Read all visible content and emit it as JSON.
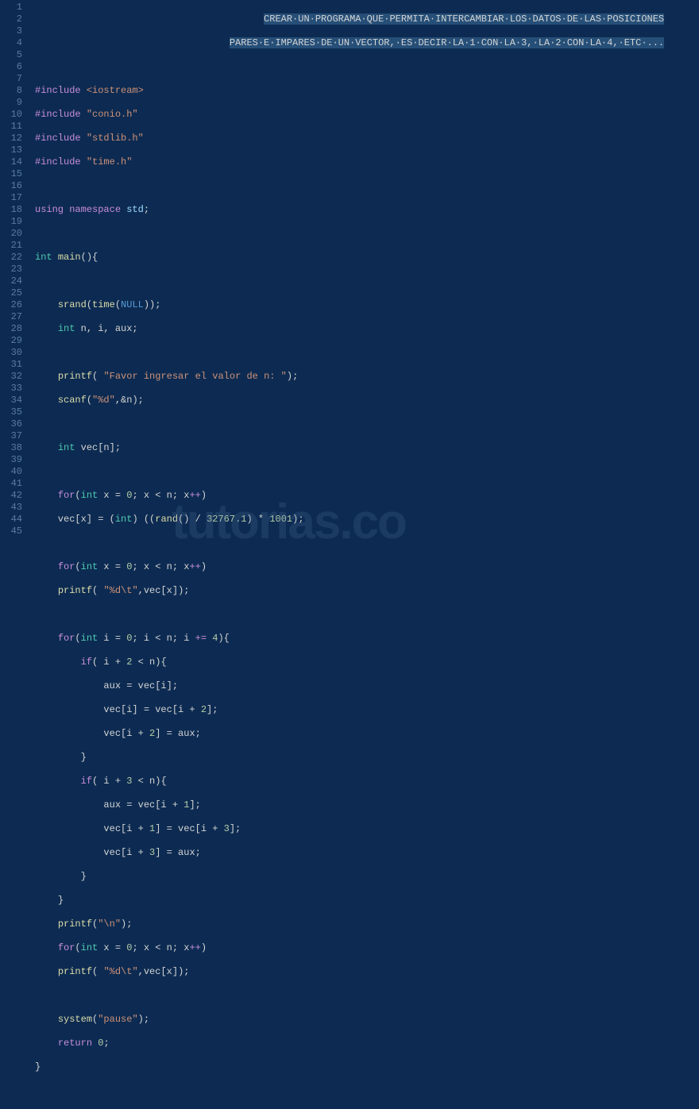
{
  "watermark": "tutorias.co",
  "gutter_start": 1,
  "gutter_end": 45,
  "comment_line1": "CREAR·UN·PROGRAMA·QUE·PERMITA·INTERCAMBIAR·LOS·DATOS·DE·LAS·POSICIONES",
  "comment_line2": "PARES·E·IMPARES·DE·UN·VECTOR,·ES·DECIR·LA·1·CON·LA·3,·LA·2·CON·LA·4,·ETC·...",
  "code_lines": {
    "l4": {
      "macro": "#include",
      "inc": "<iostream>"
    },
    "l5": {
      "macro": "#include",
      "inc": "\"conio.h\""
    },
    "l6": {
      "macro": "#include",
      "inc": "\"stdlib.h\""
    },
    "l7": {
      "macro": "#include",
      "inc": "\"time.h\""
    },
    "l9": {
      "kw1": "using",
      "kw2": "namespace",
      "ns": "std",
      "t": ";"
    },
    "l11": {
      "type": "int",
      "fn": "main",
      "t": "(){"
    },
    "l13": {
      "fn1": "srand",
      "p1": "(",
      "fn2": "time",
      "p2": "(",
      "null": "NULL",
      "t": "));"
    },
    "l14": {
      "type": "int",
      "ids": " n, i, aux;"
    },
    "l16": {
      "fn": "printf",
      "p": "( ",
      "str": "\"Favor ingresar el valor de n: \"",
      "t": ");"
    },
    "l17": {
      "fn": "scanf",
      "p": "(",
      "str": "\"%d\"",
      "t": ",&n);"
    },
    "l19": {
      "type": "int",
      "t": " vec[n];"
    },
    "l21": {
      "kw": "for",
      "p": "(",
      "type": "int",
      "id": " x = ",
      "n0": "0",
      "mid": "; x < n; x",
      "op": "++",
      "t": ")"
    },
    "l22": {
      "pre": "    vec[x] = (",
      "type": "int",
      "mid": ") ((",
      "fn": "rand",
      "p": "() / ",
      "n1": "32767.1",
      "mid2": ") * ",
      "n2": "1001",
      "t": ");"
    },
    "l24": {
      "kw": "for",
      "p": "(",
      "type": "int",
      "id": " x = ",
      "n0": "0",
      "mid": "; x < n; x",
      "op": "++",
      "t": ")"
    },
    "l25": {
      "pre": "    ",
      "fn": "printf",
      "p": "( ",
      "str": "\"%d\\t\"",
      "t": ",vec[x]);"
    },
    "l27": {
      "kw": "for",
      "p": "(",
      "type": "int",
      "id": " i = ",
      "n0": "0",
      "mid": "; i < n; i ",
      "op": "+=",
      "sp": " ",
      "n1": "4",
      "t": "){"
    },
    "l28": {
      "pre": "        ",
      "kw": "if",
      "p": "( i + ",
      "n": "2",
      "t": " < n){"
    },
    "l29": {
      "t": "            aux = vec[i];"
    },
    "l30": {
      "pre": "            vec[i] = vec[i + ",
      "n": "2",
      "t": "];"
    },
    "l31": {
      "pre": "            vec[i + ",
      "n": "2",
      "t": "] = aux;"
    },
    "l32": {
      "t": "        }"
    },
    "l33": {
      "pre": "        ",
      "kw": "if",
      "p": "( i + ",
      "n": "3",
      "t": " < n){"
    },
    "l34": {
      "pre": "            aux = vec[i + ",
      "n": "1",
      "t": "];"
    },
    "l35": {
      "pre": "            vec[i + ",
      "n1": "1",
      "mid": "] = vec[i + ",
      "n2": "3",
      "t": "];"
    },
    "l36": {
      "pre": "            vec[i + ",
      "n": "3",
      "t": "] = aux;"
    },
    "l37": {
      "t": "        }"
    },
    "l38": {
      "t": "}"
    },
    "l39": {
      "fn": "printf",
      "p": "(",
      "str": "\"\\n\"",
      "t": ");"
    },
    "l40": {
      "kw": "for",
      "p": "(",
      "type": "int",
      "id": " x = ",
      "n0": "0",
      "mid": "; x < n; x",
      "op": "++",
      "t": ")"
    },
    "l41": {
      "pre": "    ",
      "fn": "printf",
      "p": "( ",
      "str": "\"%d\\t\"",
      "t": ",vec[x]);"
    },
    "l43": {
      "fn": "system",
      "p": "(",
      "str": "\"pause\"",
      "t": ");"
    },
    "l44": {
      "kw": "return",
      "sp": " ",
      "n": "0",
      "t": ";"
    },
    "l45": {
      "t": "}"
    }
  }
}
